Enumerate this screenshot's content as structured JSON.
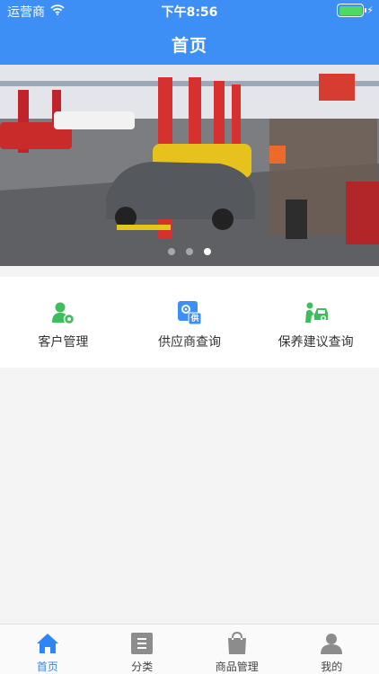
{
  "status_bar": {
    "carrier": "运营商",
    "time": "下午8:56",
    "battery_level": 1.0
  },
  "header": {
    "title": "首页"
  },
  "banner": {
    "slide_count": 3,
    "active_slide": 3
  },
  "quick_actions": [
    {
      "label": "客户管理",
      "icon": "customer-gear-icon",
      "color": "#3dbd5b"
    },
    {
      "label": "供应商查询",
      "icon": "supplier-badge-icon",
      "color": "#3d8ff5",
      "badge": "供"
    },
    {
      "label": "保养建议查询",
      "icon": "mechanic-car-icon",
      "color": "#3dbd5b"
    }
  ],
  "tabbar": {
    "active": "home",
    "tabs": [
      {
        "id": "home",
        "label": "首页",
        "icon": "home-icon"
      },
      {
        "id": "category",
        "label": "分类",
        "icon": "list-icon"
      },
      {
        "id": "products",
        "label": "商品管理",
        "icon": "shopping-bag-icon"
      },
      {
        "id": "mine",
        "label": "我的",
        "icon": "user-icon"
      }
    ]
  },
  "colors": {
    "primary": "#3d8ff5",
    "accent_green": "#3dbd5b",
    "tab_active": "#2d86f3",
    "tab_inactive": "#8c8c8c"
  }
}
